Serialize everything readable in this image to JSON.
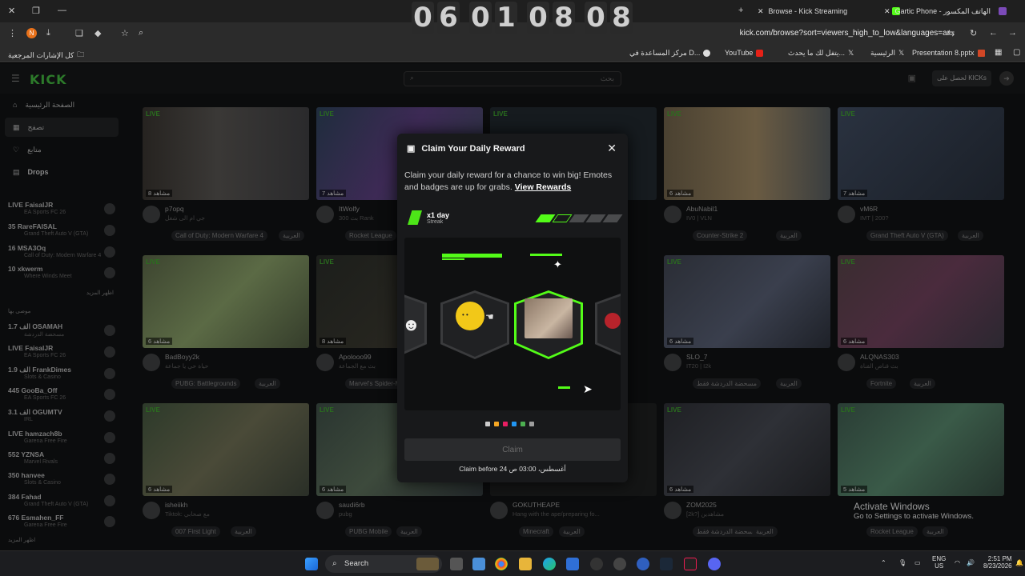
{
  "browser": {
    "timer_digits": [
      "0",
      "6",
      "0",
      "1",
      "0",
      "8",
      "0",
      "8"
    ],
    "tabs": [
      {
        "title": "Browse - Kick Streaming"
      },
      {
        "title": "Gartic Phone - الهاتف المكسور"
      }
    ],
    "url": "kick.com/browse?sort=viewers_high_to_low&languages=ar",
    "profile_initial": "N",
    "bookmarks": [
      "كل الإشارات المرجعية",
      "Presentation 8.pptx",
      "الرئيسية",
      "يتفل لك ما يحدث...",
      "YouTube",
      "مركز المساعدة في D..."
    ]
  },
  "site": {
    "logo": "KICK",
    "search_placeholder": "بحث",
    "login_label": "لحصل على KICKs",
    "nav": [
      {
        "label": "الصفحة الرئيسية",
        "icon": "home-icon"
      },
      {
        "label": "تصفح",
        "icon": "browse-icon"
      },
      {
        "label": "متابع",
        "icon": "heart-icon"
      },
      {
        "label": "Drops",
        "icon": "drops-icon"
      }
    ],
    "sidebar_channels": [
      {
        "name": "LIVE FaisalJR",
        "game": "EA Sports FC 26"
      },
      {
        "name": "35 RareFAISAL",
        "game": "Grand Theft Auto V (GTA)"
      },
      {
        "name": "16 MSA3Oq",
        "game": "Call of Duty: Modern Warfare 4"
      },
      {
        "name": "10 xkwerm",
        "game": "Where Winds Meet"
      },
      {
        "name": "1.7 الف OSAMAH",
        "game": "مسحضة الدردشة"
      },
      {
        "name": "LIVE FaisalJR",
        "game": "EA Sports FC 26"
      },
      {
        "name": "1.9 الف FrankDimes",
        "game": "Slots & Casino"
      },
      {
        "name": "445 GooBa_Off",
        "game": "EA Sports FC 26"
      },
      {
        "name": "3.1 الف OGUMTV",
        "game": "IRL"
      },
      {
        "name": "LIVE hamzach8b",
        "game": "Garena Free Fire"
      },
      {
        "name": "552 YZNSA",
        "game": "Marvel Rivals"
      },
      {
        "name": "350 hanvee",
        "game": "Slots & Casino"
      },
      {
        "name": "384 Fahad",
        "game": "Grand Theft Auto V (GTA)"
      },
      {
        "name": "676 Esmahen_FF",
        "game": "Garena Free Fire"
      }
    ],
    "sidebar_labels": {
      "more": "اظهر المزيد",
      "recommended": "موصى بها",
      "more2": "اظهر المزيد"
    },
    "cards": [
      {
        "channel": "p7opq",
        "title": "جي ام الى شغل",
        "tag": "Call of Duty: Modern Warfare 4",
        "views": "8 مشاهد",
        "lang": "العربية"
      },
      {
        "channel": "ItWolfy",
        "title": "بث 300 Rank",
        "tag": "Rocket League",
        "views": "7 مشاهد",
        "lang": "العربية"
      },
      {
        "channel": "AbuNabil1",
        "title": "IV0 | VLN",
        "tag": "Counter-Strike 2",
        "views": "6 مشاهد",
        "lang": "العربية"
      },
      {
        "channel": "vM6R",
        "title": "IMT | 200?",
        "tag": "Grand Theft Auto V (GTA)",
        "views": "7 مشاهد",
        "lang": "العربية"
      },
      {
        "channel": "BadBoyy2k",
        "title": "حياة حي يا جماعة",
        "tag": "PUBG: Battlegrounds",
        "views": "6 مشاهد",
        "lang": "العربية"
      },
      {
        "channel": "Apolooo99",
        "title": "بث مع الجماعة",
        "tag": "Marvel's Spider-Man",
        "views": "8 مشاهد",
        "lang": "العربية"
      },
      {
        "channel": "SLO_7",
        "title": "IT20 | I2k",
        "tag": "مسحضة الدردشة فقط",
        "views": "6 مشاهد",
        "lang": "العربية"
      },
      {
        "channel": "ALQNAS303",
        "title": "بث قناص القناة",
        "tag": "Fortnite",
        "views": "6 مشاهد",
        "lang": "العربية"
      },
      {
        "channel": "isheiikh",
        "title": "Tiktok: مع صحابي",
        "tag": "007 First Light",
        "views": "6 مشاهد",
        "lang": "العربية"
      },
      {
        "channel": "saudi6rb",
        "title": "pubg",
        "tag": "PUBG Mobile",
        "views": "6 مشاهد",
        "lang": "العربية"
      },
      {
        "channel": "GOKUTHEAPE",
        "title": "Hang with the ape/preparing fo...",
        "tag": "Minecraft",
        "views": "",
        "lang": "العربية"
      },
      {
        "channel": "ZOM2025",
        "title": "[2k?] مشاهدين",
        "tag": "مسحضة الدردشة فقط",
        "views": "6 مشاهد",
        "lang": "العربية"
      },
      {
        "channel": "",
        "title": "",
        "tag": "Rocket League",
        "views": "5 مشاهد",
        "lang": "العربية"
      }
    ],
    "live_badge": "LIVE"
  },
  "modal": {
    "title": "Claim Your Daily Reward",
    "description": "Claim your daily reward for a chance to win big! Emotes and badges are up for grabs.",
    "link": "View Rewards",
    "streak_count": "x1 day",
    "streak_label": "Streak",
    "streak_filled": 2,
    "streak_total": 6,
    "claim_label": "Claim",
    "claim_before": "Claim before 24 أغسطس، 03:00 ص",
    "dot_colors": [
      "#cccccc",
      "#f5a623",
      "#e91e63",
      "#2196f3",
      "#4caf50",
      "#9e9e9e"
    ],
    "accent": "#53fc18"
  },
  "windows_watermark": {
    "line1": "Activate Windows",
    "line2": "Go to Settings to activate Windows."
  },
  "taskbar": {
    "search_label": "Search",
    "lang1": "ENG",
    "lang2": "US",
    "time": "2:51 PM",
    "date": "8/23/2026"
  }
}
